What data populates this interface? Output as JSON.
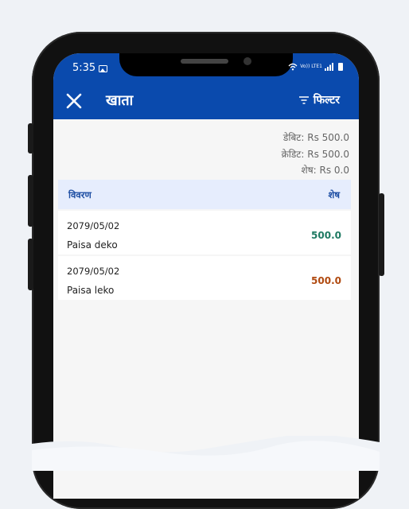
{
  "status_bar": {
    "time": "5:35",
    "network_label": "Vo)) LTE1"
  },
  "app_bar": {
    "title": "खाता",
    "filter_label": "फिल्टर"
  },
  "summary": {
    "debit_label": "डेबिट:",
    "debit_value": "Rs 500.0",
    "credit_label": "क्रेडिट:",
    "credit_value": "Rs 500.0",
    "balance_label": "शेष:",
    "balance_value": "Rs 0.0"
  },
  "table": {
    "columns": [
      "विवरण",
      "शेष"
    ],
    "rows": [
      {
        "date": "2079/05/02",
        "description": "Paisa deko",
        "amount": "500.0",
        "amount_color": "#1f7a63"
      },
      {
        "date": "2079/05/02",
        "description": "Paisa leko",
        "amount": "500.0",
        "amount_color": "#b04a10"
      }
    ]
  },
  "colors": {
    "primary": "#0a4aad",
    "header_bg": "#e6edfd",
    "debit": "#1f7a63",
    "credit": "#b04a10"
  }
}
